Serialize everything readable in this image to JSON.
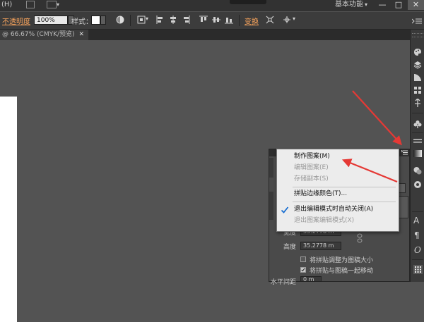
{
  "menubar": {
    "help_menu": "(H)",
    "workspace_label": "基本功能",
    "minimize_glyph": "—",
    "maximize_glyph": "□",
    "close_glyph": "✕"
  },
  "control_bar": {
    "opacity_label": "不透明度",
    "opacity_value": "100%",
    "style_label": "样式：",
    "transform_label": "变换"
  },
  "document_tab": {
    "title": "@ 66.67% (CMYK/预览)",
    "close_glyph": "✕"
  },
  "pattern_panel": {
    "width_label": "宽度",
    "width_value": "35.2778 m",
    "height_label": "高度",
    "height_value": "35.2778 m",
    "option_resize_tile": "将拼贴调整为图稿大小",
    "option_move_tile": "将拼贴与图稿一起移动",
    "h_spacing_label": "水平间距",
    "h_spacing_value": "0 m"
  },
  "context_menu": {
    "items": [
      {
        "label": "制作图案(M)",
        "enabled": true
      },
      {
        "label": "编辑图案(E)",
        "enabled": false
      },
      {
        "label": "存储副本(S)",
        "enabled": false
      },
      {
        "label": "拼贴边缘颜色(T)...",
        "enabled": true
      },
      {
        "label": "退出编辑模式时自动关闭(A)",
        "enabled": true,
        "checked": true
      },
      {
        "label": "退出图案编辑模式(X)",
        "enabled": false
      }
    ]
  },
  "colors": {
    "canvas": "#535353",
    "menu_bg": "#ececec",
    "orange_link": "#f7a35c",
    "arrow_red": "#e53935",
    "check_blue": "#1a6fd1"
  },
  "icons": [
    "palette-icon",
    "layers-icon",
    "brushes-icon",
    "graphic-styles-icon",
    "symbols-icon",
    "club-icon",
    "align-icon",
    "gradient-icon",
    "pathfinder-icon",
    "transparency-icon",
    "character-icon",
    "paragraph-icon",
    "opentype-icon",
    "swatches-icon"
  ]
}
